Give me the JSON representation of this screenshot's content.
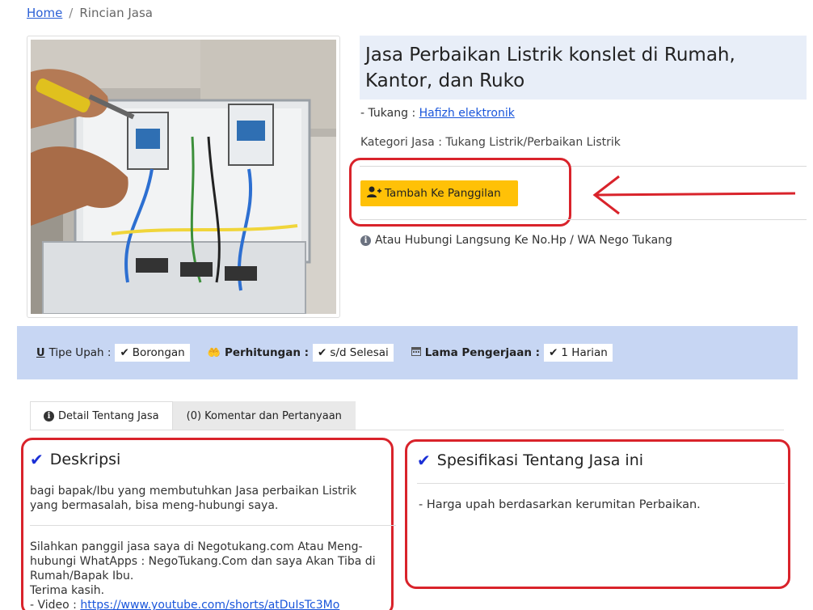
{
  "breadcrumb": {
    "home": "Home",
    "separator": "/",
    "current": "Rincian Jasa"
  },
  "service": {
    "title": "Jasa Perbaikan Listrik konslet di Rumah, Kantor, dan Ruko",
    "tukang_label": "- Tukang :",
    "tukang_name": "Hafizh elektronik",
    "kategori": "Kategori Jasa : Tukang Listrik/Perbaikan Listrik",
    "add_button": "Tambah Ke Panggilan",
    "contact": "Atau Hubungi Langsung Ke No.Hp / WA Nego Tukang"
  },
  "specs": [
    {
      "icon": "underline-u-icon",
      "label": "Tipe Upah :",
      "value": "Borongan"
    },
    {
      "icon": "hand-coin-icon",
      "label": "Perhitungan :",
      "value": "s/d Selesai"
    },
    {
      "icon": "calendar-icon",
      "label": "Lama Pengerjaan :",
      "value": "1 Harian"
    }
  ],
  "tabs": [
    {
      "label": "Detail Tentang Jasa",
      "active": true
    },
    {
      "label": "(0) Komentar dan Pertanyaan",
      "active": false
    }
  ],
  "deskripsi": {
    "title": "Deskripsi",
    "p1": "bagi bapak/Ibu yang membutuhkan Jasa perbaikan Listrik yang bermasalah, bisa meng-hubungi saya.",
    "p2_line1": "Silahkan panggil jasa saya di Negotukang.com Atau Meng-hubungi WhatApps : NegoTukang.Com dan saya Akan Tiba di Rumah/Bapak Ibu.",
    "p2_line2": "Terima kasih.",
    "video_label": "- Video :",
    "video_link": "https://www.youtube.com/shorts/atDuIsTc3Mo"
  },
  "spesifikasi": {
    "title": "Spesifikasi Tentang Jasa ini",
    "text": "- Harga upah berdasarkan kerumitan Perbaikan."
  },
  "colors": {
    "accent_yellow": "#ffc107",
    "annotation_red": "#d9232b",
    "specs_bar": "#c7d6f3",
    "title_bg": "#e8eef8",
    "check_blue": "#1a2fd6"
  }
}
